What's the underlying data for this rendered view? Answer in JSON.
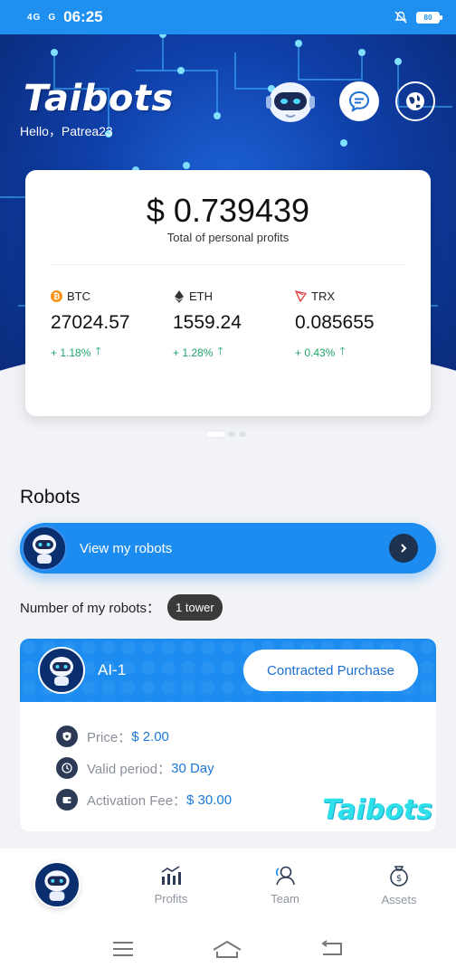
{
  "status_bar": {
    "signal_1": "4G",
    "signal_2": "G",
    "time": "06:25",
    "battery": "80"
  },
  "header": {
    "logo": "Taibots",
    "greeting": "Hello，Patrea23"
  },
  "profit": {
    "value": "$ 0.739439",
    "label": "Total of personal profits"
  },
  "coins": [
    {
      "name": "BTC",
      "price": "27024.57",
      "change": "+ 1.18%",
      "icon": "bitcoin-icon",
      "color": "#f7931a"
    },
    {
      "name": "ETH",
      "price": "1559.24",
      "change": "+ 1.28%",
      "icon": "ethereum-icon",
      "color": "#333333"
    },
    {
      "name": "TRX",
      "price": "0.085655",
      "change": "+ 0.43%",
      "icon": "tron-icon",
      "color": "#e0474b"
    }
  ],
  "robots": {
    "section_title": "Robots",
    "view_label": "View my robots",
    "count_label": "Number of my robots：",
    "count_value": "1 tower"
  },
  "robot_card": {
    "name": "AI-1",
    "purchase_label": "Contracted Purchase",
    "price_label": "Price：",
    "price_value": "$ 2.00",
    "period_label": "Valid period：",
    "period_value": "30 Day",
    "fee_label": "Activation Fee：",
    "fee_value": "$ 30.00",
    "watermark": "Taibots"
  },
  "nav": {
    "profits": "Profits",
    "team": "Team",
    "assets": "Assets"
  },
  "colors": {
    "primary": "#1c8cf0",
    "positive": "#1fa46b",
    "link_value": "#1c78d8"
  }
}
